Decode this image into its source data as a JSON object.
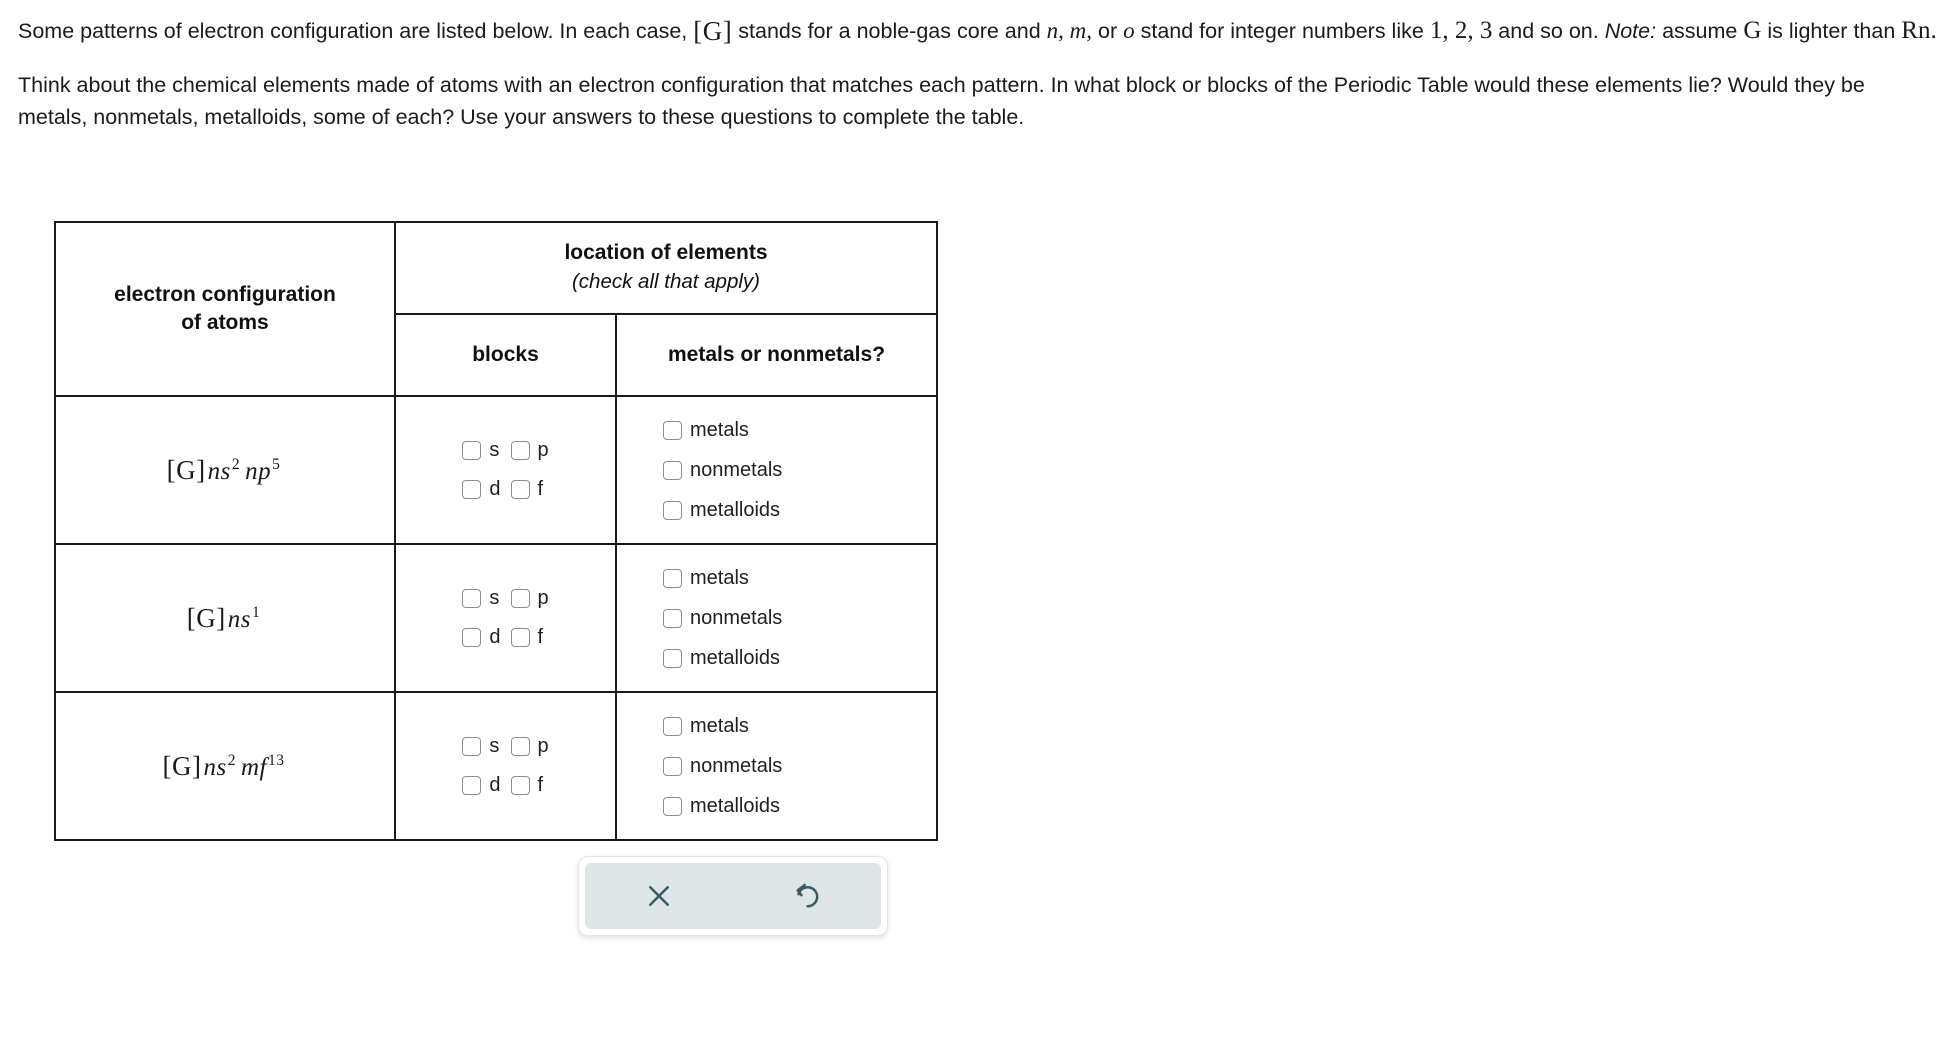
{
  "intro": {
    "para1_part1": "Some patterns of electron configuration are listed below. In each case,",
    "para1_core": "G",
    "para1_part2": "stands for a noble-gas core and",
    "para1_vars": "n, m,",
    "para1_part3": "or",
    "para1_var_o": "o",
    "para1_part4": "stand for integer numbers like",
    "para1_numbers": "1, 2, 3",
    "para1_part5": "and so on.",
    "para1_note_label": "Note:",
    "para1_note_text": "assume",
    "para1_note_G": "G",
    "para1_note_text2": "is lighter than",
    "para1_note_Rn": "Rn.",
    "para2": "Think about the chemical elements made of atoms with an electron configuration that matches each pattern. In what block or blocks of the Periodic Table would these elements lie? Would they be metals, nonmetals, metalloids, some of each? Use your answers to these questions to complete the table."
  },
  "table": {
    "header": {
      "config_column": "electron configuration of atoms",
      "config_column_line1": "electron configuration",
      "config_column_line2": "of atoms",
      "location_title": "location of elements",
      "location_subtitle": "(check all that apply)",
      "blocks_column": "blocks",
      "metals_column": "metals or nonmetals?"
    },
    "block_options": [
      {
        "id": "s",
        "label": "s",
        "checked": false
      },
      {
        "id": "p",
        "label": "p",
        "checked": false
      },
      {
        "id": "d",
        "label": "d",
        "checked": false
      },
      {
        "id": "f",
        "label": "f",
        "checked": false
      }
    ],
    "metal_options": [
      {
        "id": "metals",
        "label": "metals",
        "checked": false
      },
      {
        "id": "nonmetals",
        "label": "nonmetals",
        "checked": false
      },
      {
        "id": "metalloids",
        "label": "metalloids",
        "checked": false
      }
    ],
    "rows": [
      {
        "id": "row-1",
        "configuration_text": "[G]ns2 np5",
        "formula": {
          "core": "G",
          "terms": [
            {
              "var": "ns",
              "exp": "2"
            },
            {
              "var": "np",
              "exp": "5"
            }
          ]
        }
      },
      {
        "id": "row-2",
        "configuration_text": "[G]ns1",
        "formula": {
          "core": "G",
          "terms": [
            {
              "var": "ns",
              "exp": "1"
            }
          ]
        }
      },
      {
        "id": "row-3",
        "configuration_text": "[G]ns2 mf13",
        "formula": {
          "core": "G",
          "terms": [
            {
              "var": "ns",
              "exp": "2"
            },
            {
              "var": "mf",
              "exp": "13"
            }
          ]
        }
      }
    ]
  },
  "toolbar": {
    "clear_label": "clear",
    "reset_label": "reset",
    "clear_icon": "close-x-icon",
    "reset_icon": "undo-reset-icon",
    "background_color": "#dee5e7",
    "icon_color": "#3c5a63"
  }
}
